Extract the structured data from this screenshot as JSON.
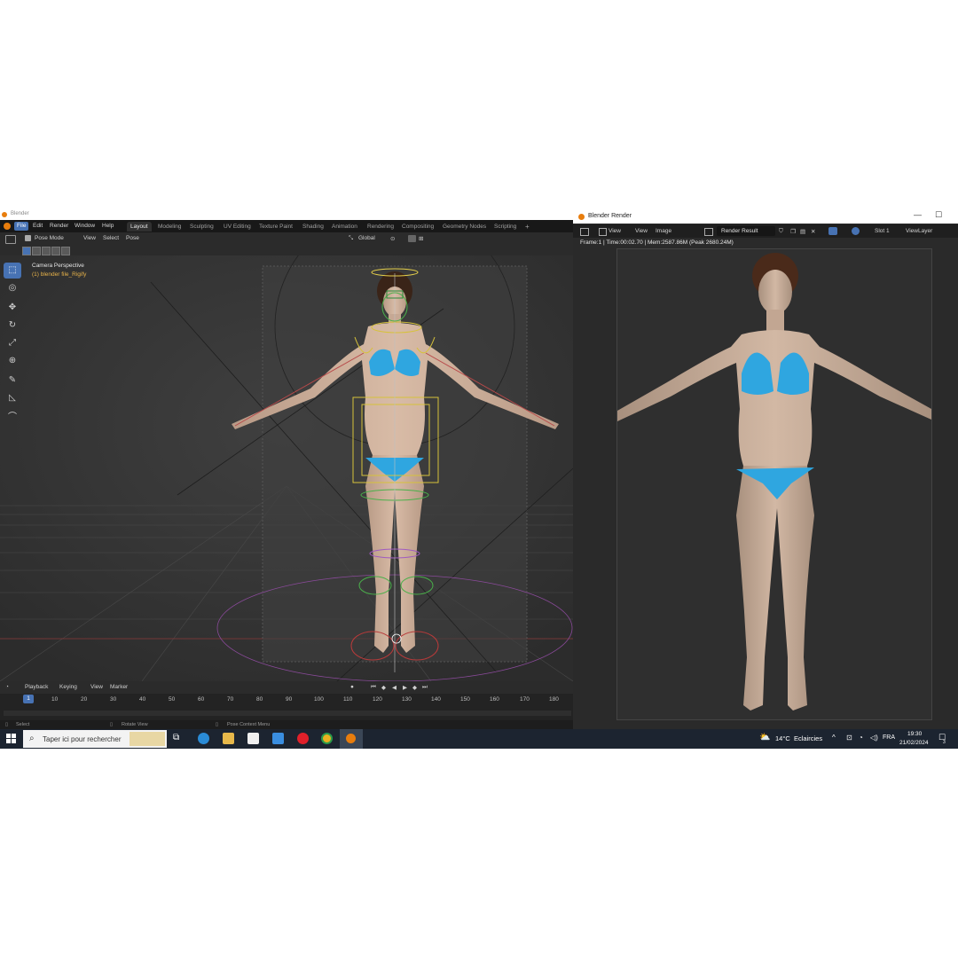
{
  "blender": {
    "window_title": "Blender",
    "menu": [
      "File",
      "Edit",
      "Render",
      "Window",
      "Help"
    ],
    "workspaces": [
      "Layout",
      "Modeling",
      "Sculpting",
      "UV Editing",
      "Texture Paint",
      "Shading",
      "Animation",
      "Rendering",
      "Compositing",
      "Geometry Nodes",
      "Scripting"
    ],
    "active_workspace": "Layout",
    "add_workspace": "+",
    "header": {
      "mode": "Pose Mode",
      "view": "View",
      "select": "Select",
      "pose": "Pose",
      "orientation": "Global"
    },
    "viewport": {
      "camera_label": "Camera Perspective",
      "object_label": "(1) blender file_Rigify"
    },
    "timeline": {
      "playback": "Playback",
      "keying": "Keying",
      "view": "View",
      "marker": "Marker",
      "current_frame": "1",
      "frames": [
        "10",
        "20",
        "30",
        "40",
        "50",
        "60",
        "70",
        "80",
        "90",
        "100",
        "110",
        "120",
        "130",
        "140",
        "150",
        "160",
        "170",
        "180"
      ]
    },
    "statusbar": {
      "select": "Select",
      "rotate": "Rotate View",
      "context": "Pose Context Menu"
    }
  },
  "render_window": {
    "title": "Blender Render",
    "view": "View",
    "view2": "View",
    "image": "Image",
    "result": "Render Result",
    "slot": "Slot 1",
    "view_layer": "ViewLayer",
    "info": "Frame:1 | Time:00:02.70 | Mem:2587.86M (Peak 2680.24M)"
  },
  "taskbar": {
    "search_placeholder": "Taper ici pour rechercher",
    "weather_temp": "14°C",
    "weather_desc": "Eclaircies",
    "language": "FRA",
    "time": "19:30",
    "date": "21/02/2024",
    "notifications": "3"
  },
  "colors": {
    "accent": "#4772b3",
    "bikini": "#2fa6e0",
    "blender_orange": "#e87d0d"
  }
}
